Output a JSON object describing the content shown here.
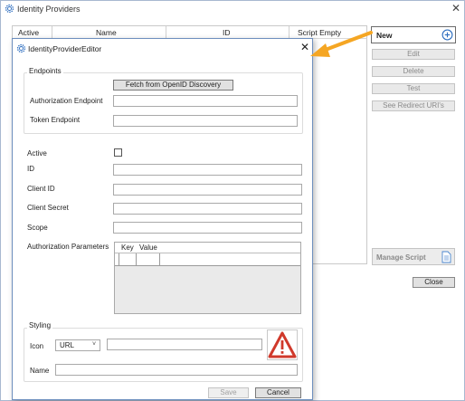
{
  "outer_window": {
    "title": "Identity Providers",
    "grid_columns": [
      "Active",
      "Name",
      "ID",
      "Script Empty"
    ],
    "new_label": "New",
    "buttons": {
      "edit": "Edit",
      "delete": "Delete",
      "test": "Test",
      "redirect": "See Redirect URI's",
      "manage_script": "Manage Script",
      "close": "Close"
    }
  },
  "dialog": {
    "title": "IdentityProviderEditor",
    "endpoints": {
      "legend": "Endpoints",
      "discovery_button": "Fetch from OpenID Discovery",
      "authorization_label": "Authorization Endpoint",
      "authorization_value": "",
      "token_label": "Token Endpoint",
      "token_value": ""
    },
    "fields": {
      "active_label": "Active",
      "active_checked": false,
      "id_label": "ID",
      "id_value": "",
      "client_id_label": "Client ID",
      "client_id_value": "",
      "client_secret_label": "Client Secret",
      "client_secret_value": "",
      "scope_label": "Scope",
      "scope_value": ""
    },
    "auth_params": {
      "label": "Authorization Parameters",
      "columns": [
        "Key",
        "Value"
      ],
      "rows": []
    },
    "styling": {
      "legend": "Styling",
      "icon_label": "Icon",
      "icon_type": "URL",
      "icon_value": "",
      "name_label": "Name",
      "name_value": ""
    },
    "buttons": {
      "save": "Save",
      "cancel": "Cancel"
    }
  },
  "colors": {
    "accent_arrow": "#f5a623",
    "icon_blue": "#2f6fc0",
    "warning_red": "#d0392b"
  },
  "icons": {
    "window": "gear-icon",
    "new": "plus-circle-icon",
    "manage_script": "document-icon",
    "icon_preview": "warning-triangle-icon"
  }
}
